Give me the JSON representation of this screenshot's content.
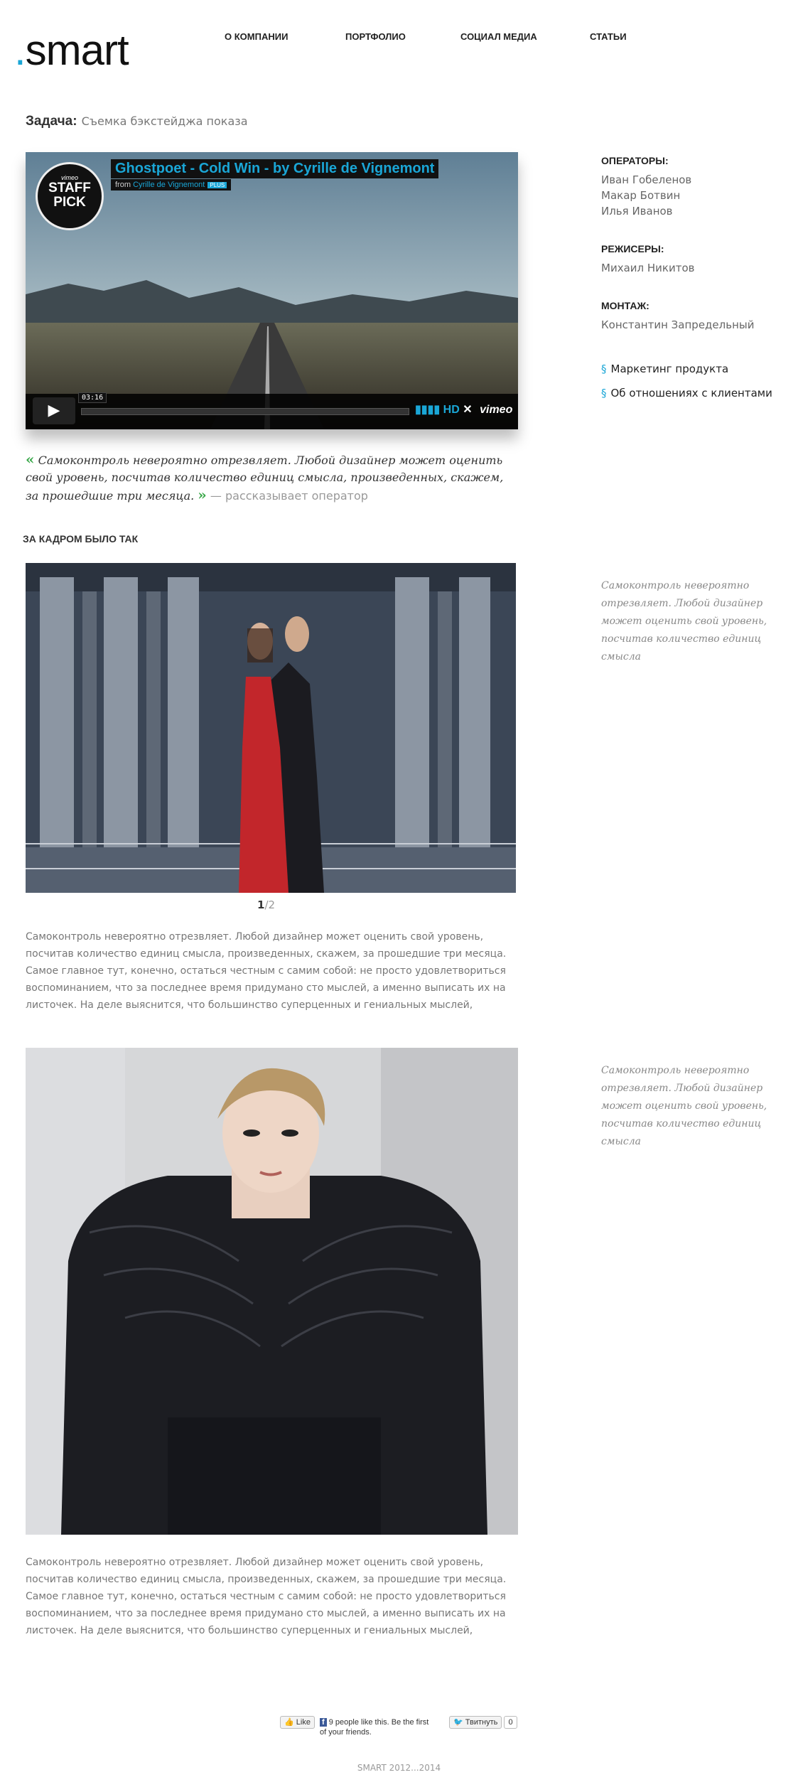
{
  "logo": {
    "dot": ".",
    "word": "smart"
  },
  "nav": [
    {
      "label": "О КОМПАНИИ"
    },
    {
      "label": "ПОРТФОЛИО"
    },
    {
      "label": "СОЦИАЛ МЕДИА"
    },
    {
      "label": "СТАТЬИ"
    }
  ],
  "task": {
    "label": "Задача:",
    "value": "Съемка бэкстейджа показа"
  },
  "video": {
    "badge_top": "vimeo",
    "badge_line1": "STAFF",
    "badge_line2": "PICK",
    "title": "Ghostpoet - Cold Win - by Cyrille de Vignemont",
    "from": "from",
    "author": "Cyrille de Vignemont",
    "plus": "PLUS",
    "time": "03:16",
    "hd": "HD",
    "brand": "vimeo",
    "play_icon": "▶"
  },
  "quote": {
    "open": "«",
    "text": "Самоконтроль невероятно отрезвляет. Любой дизайнер может оценить свой уровень, посчитав количество единиц смысла, произведенных, скажем, за прошедшие три месяца.",
    "close": "»",
    "author": "— рассказывает оператор"
  },
  "section_title": "ЗА КАДРОМ БЫЛО ТАК",
  "sidebar": {
    "operators_title": "ОПЕРАТОРЫ:",
    "operators": [
      "Иван Гобеленов",
      "Макар Ботвин",
      "Илья Иванов"
    ],
    "directors_title": "РЕЖИСЕРЫ:",
    "directors": [
      "Михаил Никитов"
    ],
    "editing_title": "МОНТАЖ:",
    "editing": [
      "Константин Запредельный"
    ],
    "links": [
      {
        "mark": "§",
        "label": "Маркетинг продукта"
      },
      {
        "mark": "§",
        "label": "Об отношениях с клиентами"
      }
    ],
    "note1": "Самоконтроль невероятно отрезвляет. Любой дизайнер может оценить свой уровень, посчитав количество единиц смысла",
    "note2": "Самоконтроль невероятно отрезвляет. Любой дизайнер может оценить свой уровень, посчитав количество единиц смысла"
  },
  "pager": {
    "current": "1",
    "sep": "/",
    "total": "2"
  },
  "paragraphs": [
    "Самоконтроль невероятно отрезвляет. Любой дизайнер может оценить свой уровень, посчитав количество единиц смысла, произведенных, скажем, за прошедшие три месяца. Самое главное тут, конечно, остаться честным с самим собой: не просто удовлетвориться воспоминанием, что за последнее время придумано сто мыслей, а именно выписать их на листочек. На деле выяснится, что большинство суперценных и гениальных мыслей,",
    "Самоконтроль невероятно отрезвляет. Любой дизайнер может оценить свой уровень, посчитав количество единиц смысла, произведенных, скажем, за прошедшие три месяца. Самое главное тут, конечно, остаться честным с самим собой: не просто удовлетвориться воспоминанием, что за последнее время придумано сто мыслей, а именно выписать их на листочек. На деле выяснится, что большинство суперценных и гениальных мыслей,"
  ],
  "social": {
    "like_label": "Like",
    "like_text": "9 people like this. Be the first of your friends.",
    "tweet_label": "Твитнуть",
    "tweet_count": "0"
  },
  "footer": {
    "copyright": "SMART 2012...2014"
  },
  "colors": {
    "accent": "#1aa6d6",
    "quote_mark": "#3aa84a"
  }
}
